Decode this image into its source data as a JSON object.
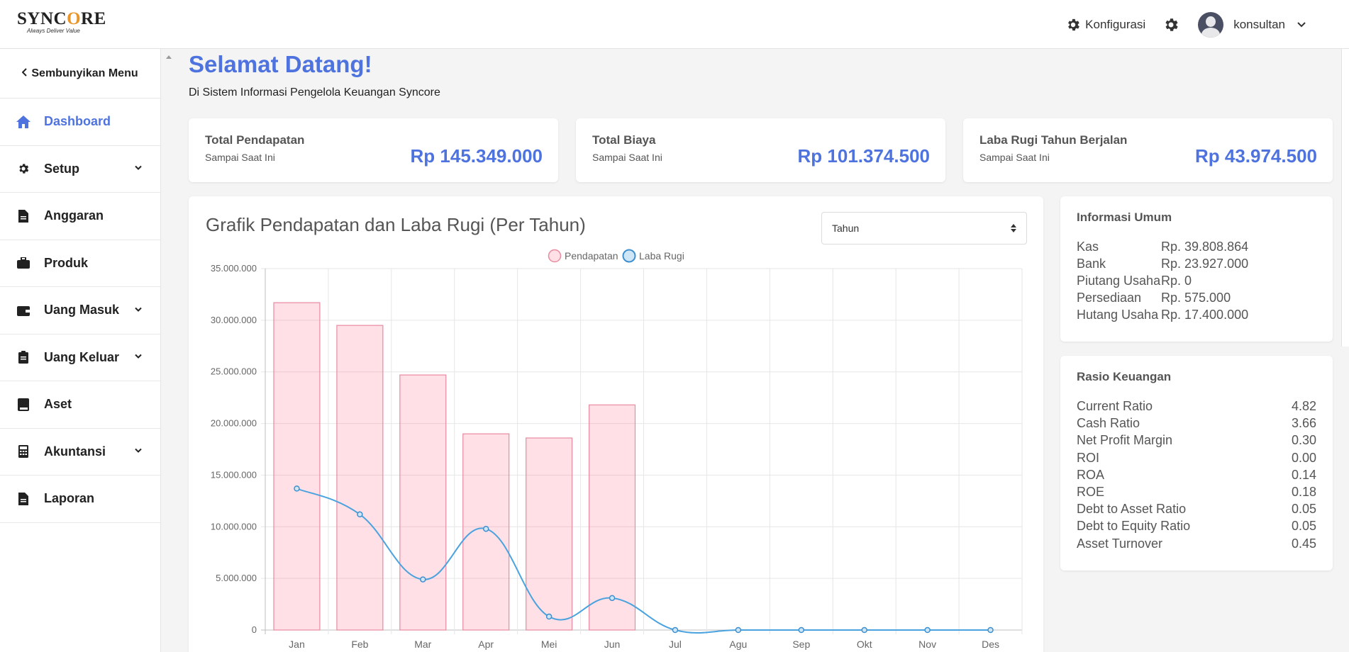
{
  "brand": {
    "name_a": "SYNC",
    "name_o": "O",
    "name_b": "RE",
    "tagline": "Always Deliver Value"
  },
  "topbar": {
    "config_label": "Konfigurasi",
    "user_name": "konsultan"
  },
  "sidebar": {
    "hide_label": "Sembunyikan Menu",
    "items": [
      {
        "label": "Dashboard",
        "icon": "home-icon",
        "active": true,
        "expandable": false
      },
      {
        "label": "Setup",
        "icon": "gear-icon",
        "active": false,
        "expandable": true
      },
      {
        "label": "Anggaran",
        "icon": "file-icon",
        "active": false,
        "expandable": false
      },
      {
        "label": "Produk",
        "icon": "briefcase-icon",
        "active": false,
        "expandable": false
      },
      {
        "label": "Uang Masuk",
        "icon": "wallet-icon",
        "active": false,
        "expandable": true
      },
      {
        "label": "Uang Keluar",
        "icon": "clipboard-icon",
        "active": false,
        "expandable": true
      },
      {
        "label": "Aset",
        "icon": "book-icon",
        "active": false,
        "expandable": false
      },
      {
        "label": "Akuntansi",
        "icon": "calculator-icon",
        "active": false,
        "expandable": true
      },
      {
        "label": "Laporan",
        "icon": "file-icon",
        "active": false,
        "expandable": false
      }
    ]
  },
  "header": {
    "title": "Selamat Datang!",
    "subtitle": "Di Sistem Informasi Pengelola Keuangan Syncore"
  },
  "stats": [
    {
      "title": "Total Pendapatan",
      "sub": "Sampai Saat Ini",
      "value": "Rp 145.349.000"
    },
    {
      "title": "Total Biaya",
      "sub": "Sampai Saat Ini",
      "value": "Rp 101.374.500"
    },
    {
      "title": "Laba Rugi Tahun Berjalan",
      "sub": "Sampai Saat Ini",
      "value": "Rp 43.974.500"
    }
  ],
  "chart_panel": {
    "title": "Grafik Pendapatan dan Laba Rugi (Per Tahun)",
    "period_select": "Tahun"
  },
  "chart_data": {
    "type": "bar",
    "categories": [
      "Jan",
      "Feb",
      "Mar",
      "Apr",
      "Mei",
      "Jun",
      "Jul",
      "Agu",
      "Sep",
      "Okt",
      "Nov",
      "Des"
    ],
    "series": [
      {
        "name": "Pendapatan",
        "type": "bar",
        "color": "#ff6384",
        "values": [
          31700000,
          29500000,
          24700000,
          19000000,
          18600000,
          21800000,
          0,
          0,
          0,
          0,
          0,
          0
        ]
      },
      {
        "name": "Laba Rugi",
        "type": "line",
        "color": "#36a2eb",
        "values": [
          13700000,
          11200000,
          4900000,
          9800000,
          1300000,
          3100000,
          0,
          0,
          0,
          0,
          0,
          0
        ]
      }
    ],
    "yticks": [
      "35.000.000",
      "30.000.000",
      "25.000.000",
      "20.000.000",
      "15.000.000",
      "10.000.000",
      "5.000.000",
      "0"
    ],
    "ylim": [
      0,
      35000000
    ],
    "grid": true,
    "legend": "top-center"
  },
  "info_umum": {
    "title": "Informasi Umum",
    "rows": [
      {
        "label": "Kas",
        "value": "Rp. 39.808.864"
      },
      {
        "label": "Bank",
        "value": "Rp. 23.927.000"
      },
      {
        "label": "Piutang Usaha",
        "value": "Rp. 0"
      },
      {
        "label": "Persediaan",
        "value": "Rp. 575.000"
      },
      {
        "label": "Hutang Usaha",
        "value": "Rp. 17.400.000"
      }
    ]
  },
  "rasio": {
    "title": "Rasio Keuangan",
    "rows": [
      {
        "label": "Current Ratio",
        "value": "4.82"
      },
      {
        "label": "Cash Ratio",
        "value": "3.66"
      },
      {
        "label": "Net Profit Margin",
        "value": "0.30"
      },
      {
        "label": "ROI",
        "value": "0.00"
      },
      {
        "label": "ROA",
        "value": "0.14"
      },
      {
        "label": "ROE",
        "value": "0.18"
      },
      {
        "label": "Debt to Asset Ratio",
        "value": "0.05"
      },
      {
        "label": "Debt to Equity Ratio",
        "value": "0.05"
      },
      {
        "label": "Asset Turnover",
        "value": "0.45"
      }
    ]
  }
}
